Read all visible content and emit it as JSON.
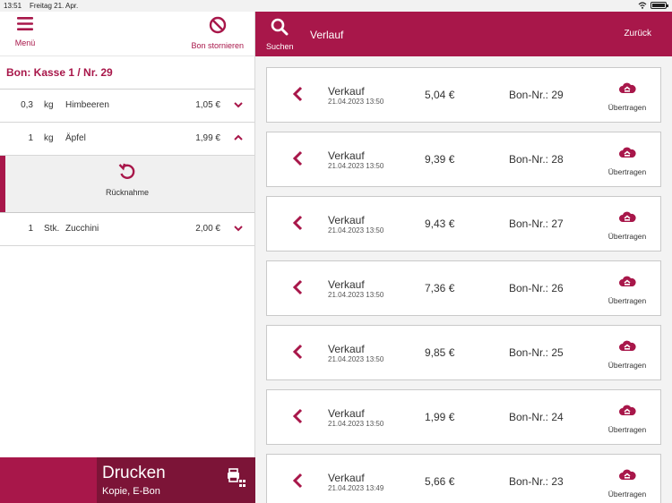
{
  "status_bar": {
    "time": "13:51",
    "date": "Freitag 21. Apr."
  },
  "left": {
    "menu_label": "Menü",
    "storno_label": "Bon stornieren",
    "bon_title": "Bon: Kasse 1 / Nr. 29",
    "items": [
      {
        "qty": "0,3",
        "unit": "kg",
        "name": "Himbeeren",
        "price": "1,05 €",
        "expanded": false
      },
      {
        "qty": "1",
        "unit": "kg",
        "name": "Äpfel",
        "price": "1,99 €",
        "expanded": true
      },
      {
        "qty": "1",
        "unit": "Stk.",
        "name": "Zucchini",
        "price": "2,00 €",
        "expanded": false
      }
    ],
    "ruecknahme_label": "Rücknahme",
    "print_label": "Drucken",
    "print_sub": "Kopie, E-Bon"
  },
  "right": {
    "search_label": "Suchen",
    "title": "Verlauf",
    "back_label": "Zurück",
    "transfer_label": "Übertragen",
    "receipts": [
      {
        "type": "Verkauf",
        "date": "21.04.2023 13:50",
        "amount": "5,04 €",
        "bon_nr": "Bon-Nr.: 29"
      },
      {
        "type": "Verkauf",
        "date": "21.04.2023 13:50",
        "amount": "9,39 €",
        "bon_nr": "Bon-Nr.: 28"
      },
      {
        "type": "Verkauf",
        "date": "21.04.2023 13:50",
        "amount": "9,43 €",
        "bon_nr": "Bon-Nr.: 27"
      },
      {
        "type": "Verkauf",
        "date": "21.04.2023 13:50",
        "amount": "7,36 €",
        "bon_nr": "Bon-Nr.: 26"
      },
      {
        "type": "Verkauf",
        "date": "21.04.2023 13:50",
        "amount": "9,85 €",
        "bon_nr": "Bon-Nr.: 25"
      },
      {
        "type": "Verkauf",
        "date": "21.04.2023 13:50",
        "amount": "1,99 €",
        "bon_nr": "Bon-Nr.: 24"
      },
      {
        "type": "Verkauf",
        "date": "21.04.2023 13:49",
        "amount": "5,66 €",
        "bon_nr": "Bon-Nr.: 23"
      }
    ]
  },
  "colors": {
    "brand": "#a8174a",
    "brand_dark": "#7c1437"
  }
}
